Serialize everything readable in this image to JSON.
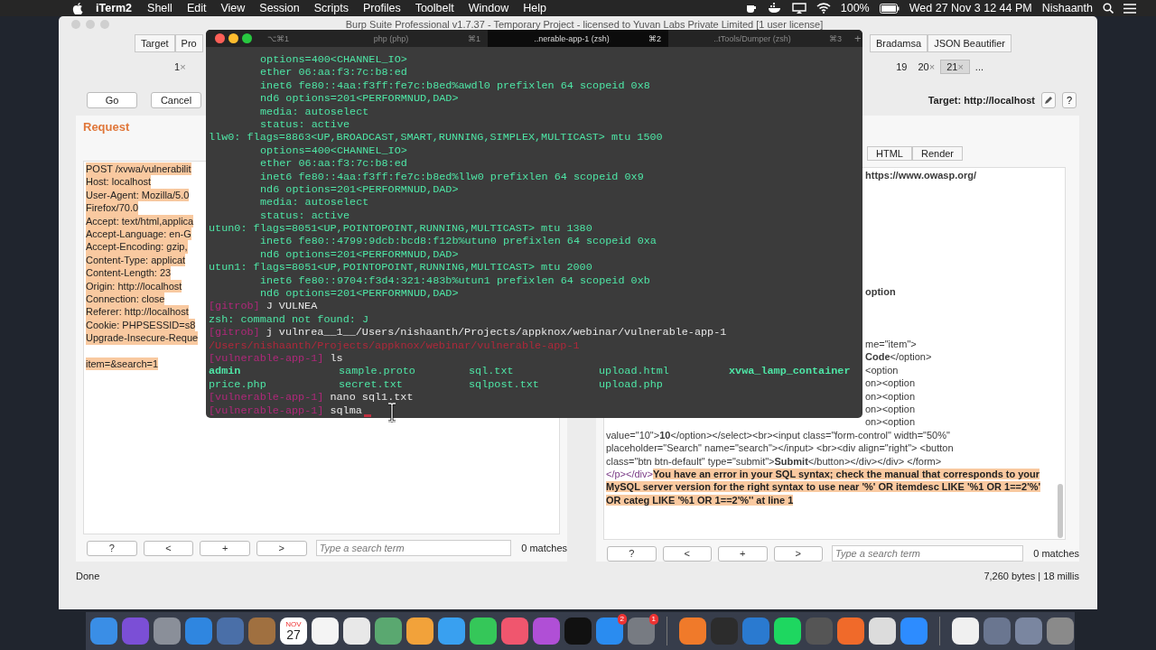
{
  "menu_bar": {
    "app": "iTerm2",
    "items": [
      "Shell",
      "Edit",
      "View",
      "Session",
      "Scripts",
      "Profiles",
      "Toolbelt",
      "Window",
      "Help"
    ],
    "battery": "100%",
    "clock": "Wed 27 Nov 3 12 44 PM",
    "user": "Nishaanth"
  },
  "burp": {
    "title": "Burp Suite Professional v1.7.37 - Temporary Project - licensed to Yuvan Labs Private Limited [1 user license]",
    "tool_tabs_left": [
      "Target",
      "Pro"
    ],
    "tool_tabs_right": [
      "Bradamsa",
      "JSON Beautifier"
    ],
    "request_tabs_left": [
      {
        "label": "1",
        "close": "×",
        "selected": false
      }
    ],
    "request_tabs_right": [
      {
        "label": "19",
        "selected": false
      },
      {
        "label": "20",
        "close": "×",
        "selected": false
      },
      {
        "label": "21",
        "close": "×",
        "selected": true
      },
      {
        "label": "...",
        "selected": false
      }
    ],
    "go": "Go",
    "cancel": "Cancel",
    "target": "Target: http://localhost",
    "help": "?",
    "request": {
      "title": "Request",
      "lines": [
        "POST /xvwa/vulnerabilit",
        "Host: localhost",
        "User-Agent: Mozilla/5.0",
        "Firefox/70.0",
        "Accept: text/html,applica",
        "Accept-Language: en-G",
        "Accept-Encoding: gzip,",
        "Content-Type: applicat",
        "Content-Length: 23",
        "Origin: http://localhost",
        "Connection: close",
        "Referer: http://localhost",
        "Cookie: PHPSESSID=s8",
        "Upgrade-Insecure-Reque"
      ],
      "body": "item=&search=1"
    },
    "response": {
      "view_tabs": [
        {
          "label": "HTML",
          "selected": false
        },
        {
          "label": "Render",
          "selected": false
        }
      ],
      "tail_lines": [
        "**https://www.owasp.org/**",
        "**option**",
        "me=\"item\">",
        "**Code**</option>",
        "<option",
        "on><option",
        "on><option",
        "on><option",
        "on><option"
      ],
      "lines": [
        "value=\"10\">**10**</option></select><br><input class=\"form-control\" width=\"50%\"",
        "placeholder=\"Search\" name=\"search\"></input> <br><div align=\"right\"> <button",
        "class=\"btn btn-default\" type=\"submit\">**Submit**</button></div></div> </form>"
      ],
      "error_prefix": "</p></div>",
      "error": "You have an error in your SQL syntax; check the manual that corresponds to your MySQL server version for the right syntax to use near '%' OR itemdesc LIKE '%1 OR 1==2'%' OR categ LIKE '%1 OR 1==2'%'' at line 1"
    },
    "search_bars": [
      {
        "buttons": [
          "?",
          "<",
          "+",
          ">"
        ],
        "placeholder": "Type a search term",
        "matches": "0 matches"
      },
      {
        "buttons": [
          "?",
          "<",
          "+",
          ">"
        ],
        "placeholder": "Type a search term",
        "matches": "0 matches"
      }
    ],
    "status": "Done",
    "stats": "7,260 bytes | 18 millis"
  },
  "terminal": {
    "lead_shortcut": "⌥⌘1",
    "new_tab": "+",
    "tabs": [
      {
        "label": "php (php)",
        "shortcut": "⌘1",
        "selected": false
      },
      {
        "label": "..nerable-app-1 (zsh)",
        "shortcut": "⌘2",
        "selected": true
      },
      {
        "label": "..tTools/Dumper (zsh)",
        "shortcut": "⌘3",
        "selected": false
      }
    ],
    "lines": [
      {
        "kind": "indent",
        "text": "options=400<CHANNEL_IO>"
      },
      {
        "kind": "indent",
        "text": "ether 06:aa:f3:7c:b8:ed"
      },
      {
        "kind": "indent",
        "text": "inet6 fe80::4aa:f3ff:fe7c:b8ed%awdl0 prefixlen 64 scopeid 0x8"
      },
      {
        "kind": "indent",
        "text": "nd6 options=201<PERFORMNUD,DAD>"
      },
      {
        "kind": "indent",
        "text": "media: autoselect"
      },
      {
        "kind": "indent",
        "text": "status: active"
      },
      {
        "kind": "plain",
        "text": "llw0: flags=8863<UP,BROADCAST,SMART,RUNNING,SIMPLEX,MULTICAST> mtu 1500"
      },
      {
        "kind": "indent",
        "text": "options=400<CHANNEL_IO>"
      },
      {
        "kind": "indent",
        "text": "ether 06:aa:f3:7c:b8:ed"
      },
      {
        "kind": "indent",
        "text": "inet6 fe80::4aa:f3ff:fe7c:b8ed%llw0 prefixlen 64 scopeid 0x9"
      },
      {
        "kind": "indent",
        "text": "nd6 options=201<PERFORMNUD,DAD>"
      },
      {
        "kind": "indent",
        "text": "media: autoselect"
      },
      {
        "kind": "indent",
        "text": "status: active"
      },
      {
        "kind": "plain",
        "text": "utun0: flags=8051<UP,POINTOPOINT,RUNNING,MULTICAST> mtu 1380"
      },
      {
        "kind": "indent",
        "text": "inet6 fe80::4799:9dcb:bcd8:f12b%utun0 prefixlen 64 scopeid 0xa"
      },
      {
        "kind": "indent",
        "text": "nd6 options=201<PERFORMNUD,DAD>"
      },
      {
        "kind": "plain",
        "text": "utun1: flags=8051<UP,POINTOPOINT,RUNNING,MULTICAST> mtu 2000"
      },
      {
        "kind": "indent",
        "text": "inet6 fe80::9704:f3d4:321:483b%utun1 prefixlen 64 scopeid 0xb"
      },
      {
        "kind": "indent",
        "text": "nd6 options=201<PERFORMNUD,DAD>"
      },
      {
        "kind": "prompt",
        "prompt": "[gitrob]",
        "text": "J VULNEA"
      },
      {
        "kind": "plain",
        "text": "zsh: command not found: J"
      },
      {
        "kind": "prompt",
        "prompt": "[gitrob]",
        "text": "j vulnrea__1__/Users/nishaanth/Projects/appknox/webinar/vulnerable-app-1"
      },
      {
        "kind": "error",
        "text": "/Users/nishaanth/Projects/appknox/webinar/vulnerable-app-1"
      },
      {
        "kind": "prompt",
        "prompt": "[vulnerable-app-1]",
        "text": "ls"
      },
      {
        "kind": "files",
        "files": [
          {
            "name": "admin",
            "kind": "dir"
          },
          {
            "name": "sample.proto",
            "kind": "file"
          },
          {
            "name": "sql.txt",
            "kind": "file"
          },
          {
            "name": "upload.html",
            "kind": "file"
          },
          {
            "name": "xvwa_lamp_container",
            "kind": "dir"
          }
        ]
      },
      {
        "kind": "files",
        "files": [
          {
            "name": "price.php",
            "kind": "file"
          },
          {
            "name": "secret.txt",
            "kind": "file"
          },
          {
            "name": "sqlpost.txt",
            "kind": "file"
          },
          {
            "name": "upload.php",
            "kind": "file"
          }
        ]
      },
      {
        "kind": "prompt",
        "prompt": "[vulnerable-app-1]",
        "text": "nano sql1.txt"
      },
      {
        "kind": "prompt",
        "prompt": "[vulnerable-app-1]",
        "text": "sqlma"
      }
    ]
  },
  "dock": {
    "calendar_month": "NOV",
    "calendar_day": "27",
    "badges": [
      "2",
      "1"
    ]
  }
}
